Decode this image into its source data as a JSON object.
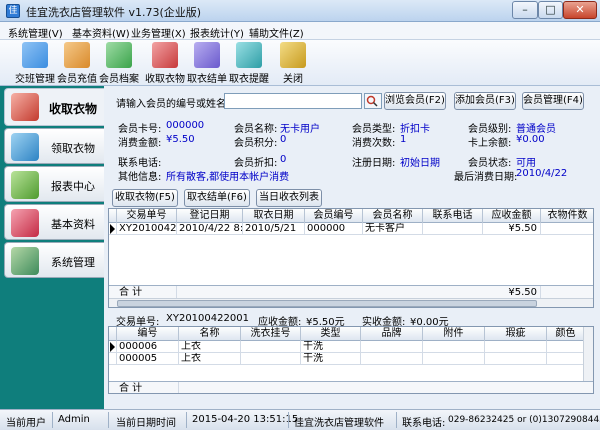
{
  "window": {
    "title": "佳宜洗衣店管理软件 v1.73(企业版)",
    "app_icon": "佳"
  },
  "menu": [
    "系统管理(V)",
    "基本资料(W)",
    "业务管理(X)",
    "报表统计(Y)",
    "辅助文件(Z)"
  ],
  "toolbar": [
    {
      "label": "交班管理",
      "icon": "handover-icon",
      "color": "#3b8de0"
    },
    {
      "label": "会员充值",
      "icon": "member-recharge-icon",
      "color": "#d98a2b"
    },
    {
      "label": "会员档案",
      "icon": "member-file-icon",
      "color": "#3aa34a"
    },
    {
      "label": "收取衣物",
      "icon": "receive-clothes-icon",
      "color": "#c7393b"
    },
    {
      "label": "取衣结单",
      "icon": "pickup-checkout-icon",
      "color": "#6a5acd"
    },
    {
      "label": "取衣提醒",
      "icon": "pickup-reminder-icon",
      "color": "#2e9ea6"
    },
    {
      "label": "关闭",
      "icon": "close-app-icon",
      "color": "#c79a1e"
    }
  ],
  "sidebar": [
    {
      "label": "收取衣物",
      "active": true
    },
    {
      "label": "领取衣物",
      "active": false
    },
    {
      "label": "报表中心",
      "active": false
    },
    {
      "label": "基本资料",
      "active": false
    },
    {
      "label": "系统管理",
      "active": false
    }
  ],
  "search": {
    "label": "请输入会员的编号或姓名:",
    "value": ""
  },
  "buttons": {
    "browse": "浏览会员(F2)",
    "add": "添加会员(F3)",
    "manage": "会员管理(F4)",
    "receive": "收取衣物(F5)",
    "checkout": "取衣结单(F6)",
    "today": "当日收衣列表"
  },
  "member": {
    "card_no_label": "会员卡号:",
    "card_no": "000000",
    "name_label": "会员名称:",
    "name": "无卡用户",
    "type_label": "会员类型:",
    "type": "折扣卡",
    "level_label": "会员级别:",
    "level": "普通会员",
    "consume_label": "消费金额:",
    "consume": "¥5.50",
    "points_label": "会员积分:",
    "points": "0",
    "count_label": "消费次数:",
    "count": "1",
    "balance_label": "卡上余额:",
    "balance": "¥0.00",
    "phone_label": "联系电话:",
    "phone": "",
    "discount_label": "会员折扣:",
    "discount": "0",
    "reg_label": "注册日期:",
    "reg": "初始日期",
    "status_label": "会员状态:",
    "status": "可用",
    "other_label": "其他信息:",
    "other": "所有散客,都使用本帐户消费",
    "last_label": "最后消费日期:",
    "last": "2010/4/22"
  },
  "orders": {
    "columns": [
      "交易单号",
      "登记日期",
      "取衣日期",
      "会员编号",
      "会员名称",
      "联系电话",
      "应收金额",
      "衣物件数"
    ],
    "rows": [
      [
        "XY20100422001",
        "2010/4/22 8:5",
        "2010/5/21",
        "000000",
        "无卡客户",
        "",
        "¥5.50",
        ""
      ]
    ],
    "total_label": "合  计",
    "total_amount": "¥5.50"
  },
  "trade": {
    "no_label": "交易单号:",
    "no": "XY20100422001",
    "due_label": "应收金额:",
    "due": "¥5.50元",
    "paid_label": "实收金额:",
    "paid": "¥0.00元"
  },
  "items": {
    "columns": [
      "编号",
      "名称",
      "洗衣挂号",
      "类型",
      "品牌",
      "附件",
      "瑕疵",
      "颜色"
    ],
    "rows": [
      [
        "000006",
        "上衣",
        "",
        "干洗",
        "",
        "",
        "",
        ""
      ],
      [
        "000005",
        "上衣",
        "",
        "干洗",
        "",
        "",
        "",
        ""
      ]
    ],
    "total_label": "合  计"
  },
  "status": {
    "user_label": "当前用户",
    "user": "Admin",
    "date_label": "当前日期时间",
    "datetime": "2015-04-20 13:51:15",
    "product": "佳宜洗衣店管理软件",
    "phone_label": "联系电话:",
    "phone": "029-86232425 or (0)13072908445"
  }
}
